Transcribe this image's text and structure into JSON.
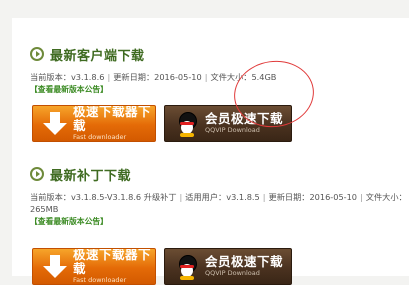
{
  "client": {
    "title": "最新客户端下载",
    "version_label": "当前版本：v3.1.8.6",
    "update_label": "更新日期：2016-05-10",
    "size_label": "文件大小：5.4GB",
    "notice_link": "【查看最新版本公告】",
    "fast_btn_main": "极速下载器下载",
    "fast_btn_sub": "Fast downloader",
    "vip_btn_main": "会员极速下载",
    "vip_btn_sub": "QQVIP Download"
  },
  "patch": {
    "title": "最新补丁下载",
    "version_label": "当前版本：v3.1.8.5-V3.1.8.6",
    "patch_type": "升级补丁",
    "users_label": "适用用户：v3.1.8.5",
    "update_label": "更新日期：2016-05-10",
    "size_label_prefix": "文件大小：",
    "size_value": "265MB",
    "notice_link": "【查看最新版本公告】",
    "fast_btn_main": "极速下载器下载",
    "fast_btn_sub": "Fast downloader",
    "vip_btn_main": "会员极速下载",
    "vip_btn_sub": "QQVIP Download"
  },
  "separator": "|",
  "colors": {
    "title_green": "#3f6b21",
    "link_green": "#3a8a22",
    "fast_orange": "#e46a07",
    "vip_brown": "#4a3220",
    "annotation_red": "#e03a3a"
  },
  "icons": {
    "section_bullet": "circle-play-icon",
    "fast_button": "download-arrow-icon",
    "vip_button": "qq-penguin-icon"
  }
}
